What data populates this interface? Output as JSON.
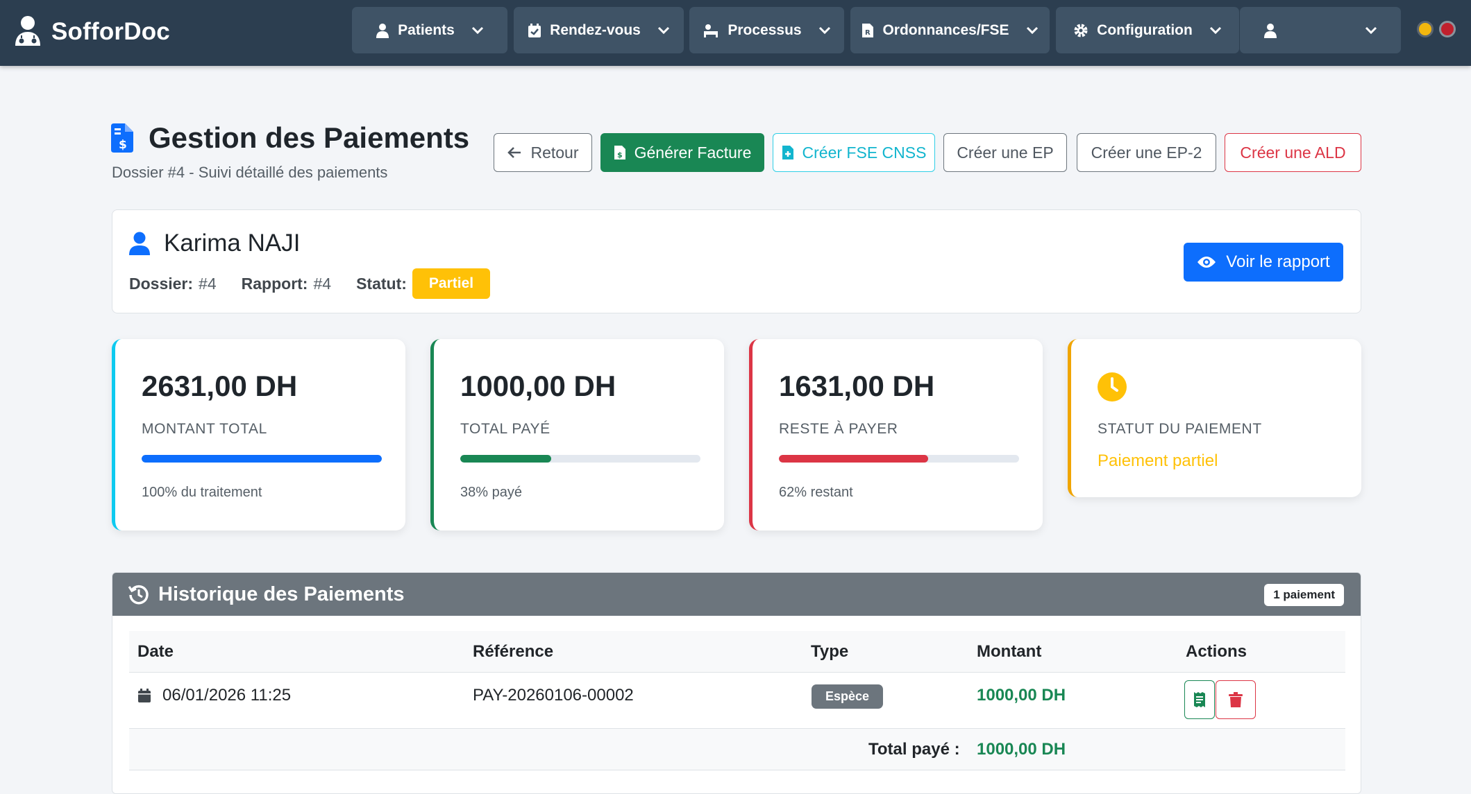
{
  "navbar": {
    "brand": "SofforDoc",
    "menus": [
      {
        "label": "Patients",
        "icon": "user-injured-icon"
      },
      {
        "label": "Rendez-vous",
        "icon": "calendar-check-icon"
      },
      {
        "label": "Processus",
        "icon": "procedures-icon"
      },
      {
        "label": "Ordonnances/FSE",
        "icon": "prescription-file-icon"
      },
      {
        "label": "Configuration",
        "icon": "gear-icon"
      },
      {
        "label": "",
        "icon": "user-icon"
      }
    ]
  },
  "header": {
    "title": "Gestion des Paiements",
    "subtitle": "Dossier #4 - Suivi détaillé des paiements",
    "buttons": {
      "back": "Retour",
      "invoice": "Générer Facture",
      "fse": "Créer FSE CNSS",
      "ep": "Créer une EP",
      "ep2": "Créer une EP-2",
      "ald": "Créer une ALD"
    }
  },
  "patient": {
    "name": "Karima NAJI",
    "dossier_label": "Dossier:",
    "dossier_value": "#4",
    "rapport_label": "Rapport:",
    "rapport_value": "#4",
    "statut_label": "Statut:",
    "statut_value": "Partiel",
    "report_button": "Voir le rapport"
  },
  "stats": {
    "total": {
      "amount": "2631,00 DH",
      "label": "MONTANT TOTAL",
      "note": "100% du traitement",
      "progress": 1.0,
      "color": "#0d6efd"
    },
    "paid": {
      "amount": "1000,00 DH",
      "label": "TOTAL PAYÉ",
      "note": "38% payé",
      "progress": 0.38,
      "color": "#198754"
    },
    "remaining": {
      "amount": "1631,00 DH",
      "label": "RESTE À PAYER",
      "note": "62% restant",
      "progress": 0.62,
      "color": "#dc3545"
    },
    "status": {
      "label": "STATUT DU PAIEMENT",
      "value": "Paiement partiel"
    }
  },
  "history": {
    "title": "Historique des Paiements",
    "count": "1 paiement",
    "columns": [
      "Date",
      "Référence",
      "Type",
      "Montant",
      "Actions"
    ],
    "rows": [
      {
        "date": "06/01/2026 11:25",
        "reference": "PAY-20260106-00002",
        "type": "Espèce",
        "amount": "1000,00 DH"
      }
    ],
    "total_label": "Total payé :",
    "total_value": "1000,00 DH"
  }
}
